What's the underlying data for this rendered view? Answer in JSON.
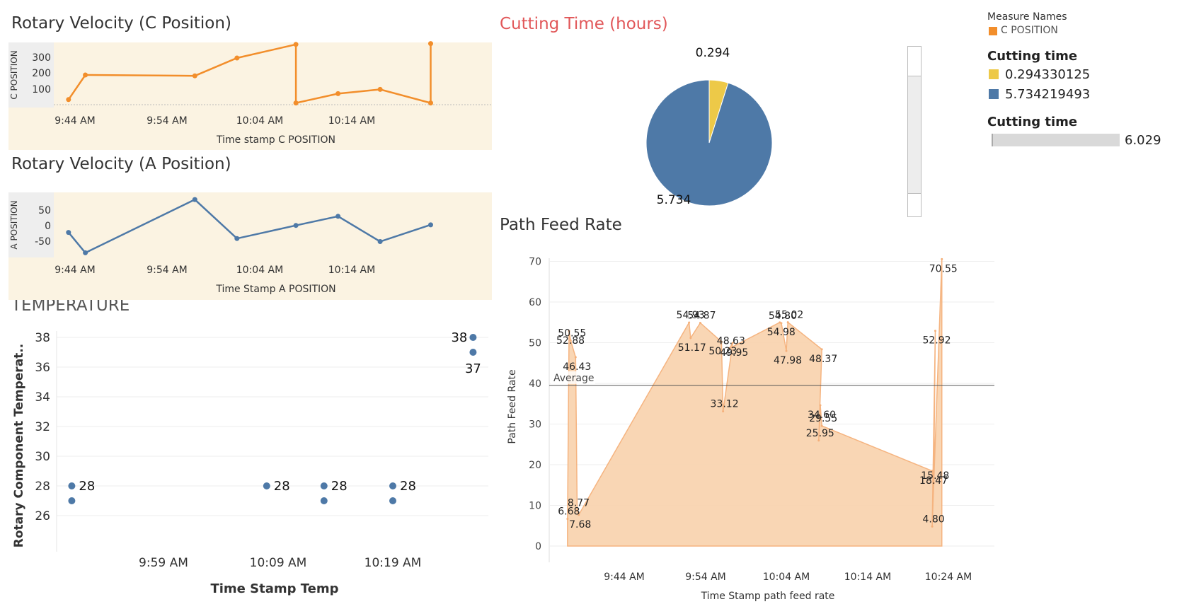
{
  "colors": {
    "c_line": "#f28e2b",
    "a_line": "#4e79a7",
    "temp_dot": "#4e79a7",
    "pie_small": "#edc948",
    "pie_large": "#4e79a7",
    "area_fill": "#f9d4b0",
    "area_line": "#f5b07a",
    "panel_bg": "#fbf3e2"
  },
  "chart_data": [
    {
      "id": "c_position",
      "type": "line",
      "title": "Rotary Velocity (C Position)",
      "xlabel": "Time stamp C POSITION",
      "ylabel": "C POSITION",
      "yticks": [
        "300",
        "200",
        "100"
      ],
      "xticks": [
        "9:44 AM",
        "9:54 AM",
        "10:04 AM",
        "10:14 AM"
      ],
      "x": [
        "9:36",
        "9:38",
        "9:51",
        "9:56",
        "10:03",
        "10:03",
        "10:08",
        "10:13",
        "10:19",
        "10:19"
      ],
      "values": [
        30,
        175,
        170,
        275,
        355,
        10,
        65,
        90,
        10,
        360
      ],
      "ylim": [
        0,
        380
      ]
    },
    {
      "id": "a_position",
      "type": "line",
      "title": "Rotary Velocity (A Position)",
      "xlabel": "Time Stamp A POSITION",
      "ylabel": "A POSITION",
      "yticks": [
        "50",
        "0",
        "-50"
      ],
      "xticks": [
        "9:44 AM",
        "9:54 AM",
        "10:04 AM",
        "10:14 AM"
      ],
      "x": [
        "9:36",
        "9:38",
        "9:51",
        "9:56",
        "10:03",
        "10:08",
        "10:13",
        "10:19"
      ],
      "values": [
        -20,
        -87,
        88,
        -40,
        3,
        33,
        -50,
        5
      ],
      "ylim": [
        -90,
        90
      ]
    },
    {
      "id": "temperature",
      "type": "scatter",
      "title": "TEMPERATURE",
      "xlabel": "Time Stamp Temp",
      "ylabel": "Rotary Component Temperat..",
      "yticks": [
        "38",
        "36",
        "34",
        "32",
        "30",
        "28",
        "26"
      ],
      "xticks": [
        "9:59 AM",
        "10:09 AM",
        "10:19 AM"
      ],
      "points": [
        {
          "x": "9:51",
          "y": 28,
          "label": "28"
        },
        {
          "x": "9:51",
          "y": 27
        },
        {
          "x": "10:08",
          "y": 28,
          "label": "28"
        },
        {
          "x": "10:13",
          "y": 28,
          "label": "28"
        },
        {
          "x": "10:13",
          "y": 27
        },
        {
          "x": "10:19",
          "y": 28,
          "label": "28"
        },
        {
          "x": "10:19",
          "y": 27
        },
        {
          "x": "10:26",
          "y": 38,
          "label": "38"
        },
        {
          "x": "10:26",
          "y": 37,
          "label": "37"
        }
      ],
      "ylim": [
        26,
        39
      ]
    },
    {
      "id": "cutting_time",
      "type": "pie",
      "title": "Cutting Time (hours)",
      "labels": [
        "0.294",
        "5.734"
      ],
      "values": [
        0.294330125,
        5.734219493
      ]
    },
    {
      "id": "path_feed_rate",
      "type": "area",
      "title": "Path Feed Rate",
      "xlabel": "Time Stamp path feed rate",
      "ylabel": "Path Feed Rate",
      "yticks": [
        "70",
        "60",
        "50",
        "40",
        "30",
        "20",
        "10",
        "0"
      ],
      "xticks": [
        "9:44 AM",
        "9:54 AM",
        "10:04 AM",
        "10:14 AM",
        "10:24 AM"
      ],
      "reference_line": {
        "label": "Average",
        "value": 39.5
      },
      "x": [
        "9:37",
        "9:37",
        "9:37",
        "9:38",
        "9:38",
        "9:38",
        "9:52",
        "9:52",
        "9:53",
        "9:56",
        "9:56",
        "9:57",
        "9:57",
        "10:03",
        "10:03",
        "10:04",
        "10:04",
        "10:08",
        "10:08",
        "10:08",
        "10:08",
        "10:22",
        "10:22",
        "10:22",
        "10:22",
        "10:23",
        "10:23",
        "10:23",
        "10:23"
      ],
      "values": [
        6.68,
        52.88,
        50.55,
        46.43,
        8.77,
        7.68,
        54.93,
        51.17,
        54.87,
        50.23,
        33.12,
        49.95,
        48.63,
        54.98,
        54.8,
        47.98,
        55.02,
        48.37,
        25.95,
        34.6,
        29.55,
        18.47,
        15.48,
        52.92,
        4.8,
        70.55
      ],
      "labels": [
        "6.68",
        "52.88",
        "50.55",
        "46.43",
        "8.77",
        "7.68",
        "54.93",
        "51.17",
        "54.87",
        "50.23",
        "33.12",
        "49.95",
        "48.63",
        "54.98",
        "54.80",
        "47.98",
        "55.02",
        "48.37",
        "25.95",
        "34.60",
        "29.55",
        "18.47",
        "15.48",
        "52.92",
        "4.80",
        "70.55"
      ],
      "ylim": [
        0,
        72
      ]
    }
  ],
  "legend": {
    "measure_names_title": "Measure Names",
    "measure_names_item": "C POSITION",
    "cutting_time_title": "Cutting time",
    "cutting_items": [
      "0.294330125",
      "5.734219493"
    ],
    "cutting_time_title2": "Cutting time",
    "slider_value": "6.029"
  }
}
